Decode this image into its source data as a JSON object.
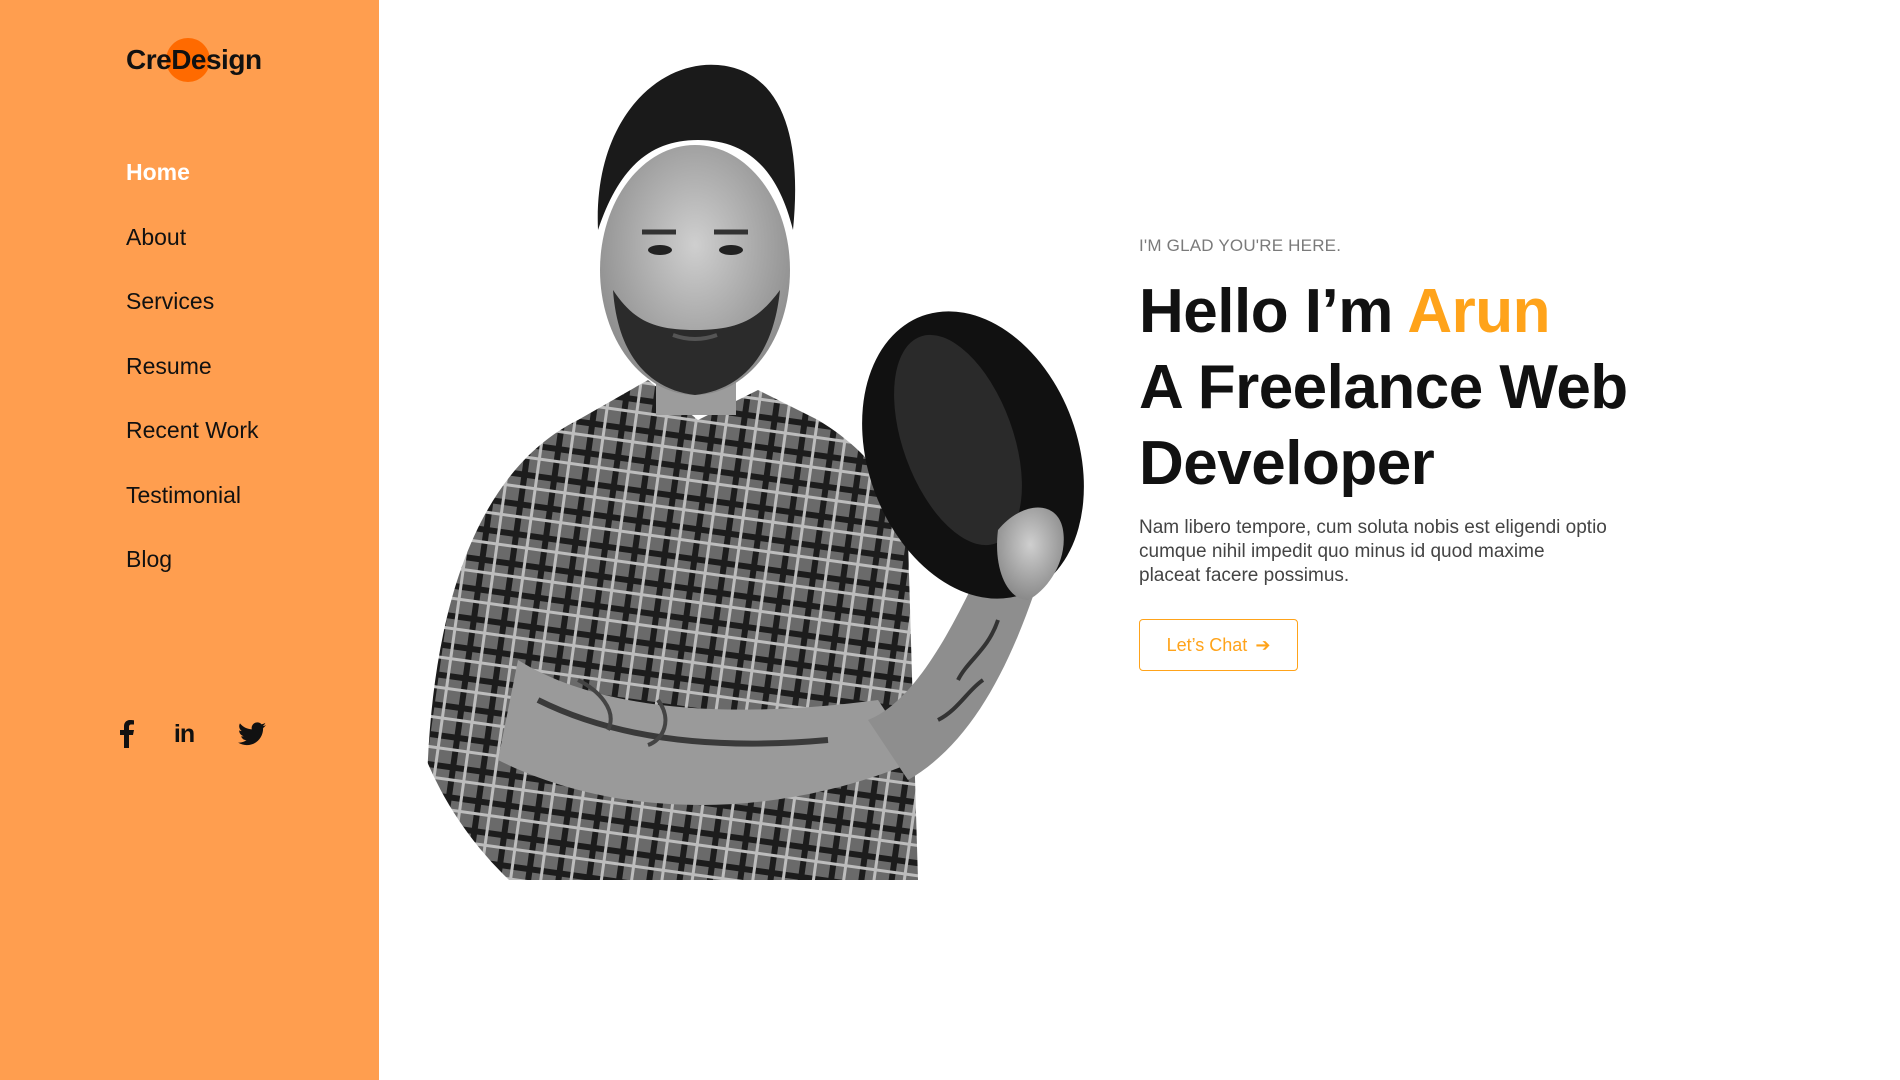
{
  "brand": {
    "logo_text": "CreDesign"
  },
  "sidebar": {
    "nav": [
      {
        "label": "Home",
        "active": true
      },
      {
        "label": "About"
      },
      {
        "label": "Services"
      },
      {
        "label": "Resume"
      },
      {
        "label": "Recent Work"
      },
      {
        "label": "Testimonial"
      },
      {
        "label": "Blog"
      }
    ],
    "social": [
      {
        "icon": "facebook-icon"
      },
      {
        "icon": "linkedin-icon",
        "text": "in"
      },
      {
        "icon": "twitter-icon"
      }
    ]
  },
  "hero": {
    "greeting": "I'M GLAD YOU'RE HERE.",
    "headline_prefix": "Hello I’m ",
    "headline_name": "Arun",
    "headline_line2": "A Freelance Web",
    "headline_line3": "Developer",
    "description": "Nam libero tempore, cum soluta nobis est eligendi optio cumque nihil impedit quo minus id quod maxime placeat facere possimus.",
    "cta_label": "Let’s Chat",
    "cta_arrow": "➔"
  },
  "colors": {
    "sidebar_bg": "#ff9e4f",
    "accent": "#ffa31a",
    "logo_dot": "#ff6a00",
    "text_dark": "#111111"
  }
}
